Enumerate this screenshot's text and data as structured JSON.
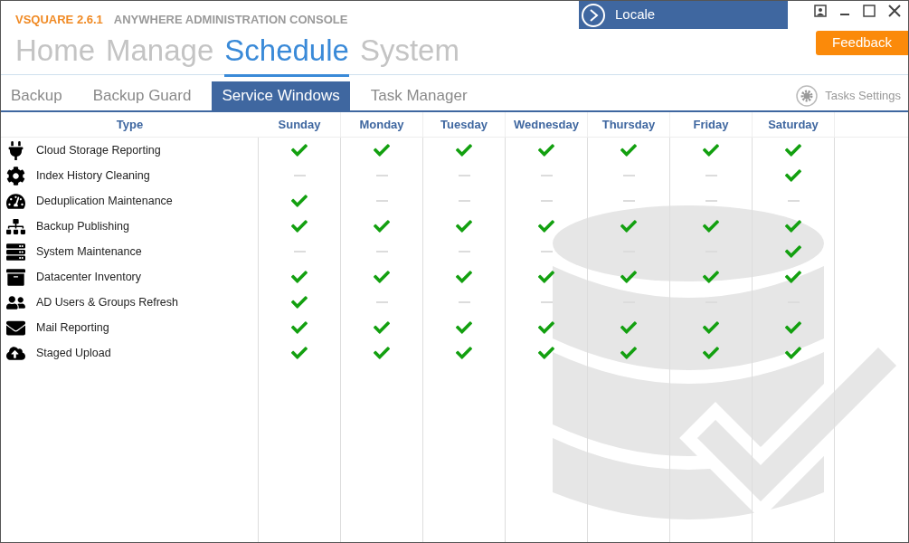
{
  "app": {
    "brand": "VSQUARE 2.6.1",
    "title": "ANYWHERE ADMINISTRATION CONSOLE"
  },
  "locale": {
    "label": "Locale"
  },
  "feedback": "Feedback",
  "nav": [
    {
      "label": "Home",
      "selected": false
    },
    {
      "label": "Manage",
      "selected": false
    },
    {
      "label": "Schedule",
      "selected": true
    },
    {
      "label": "System",
      "selected": false
    }
  ],
  "subtabs": [
    {
      "label": "Backup",
      "selected": false
    },
    {
      "label": "Backup Guard",
      "selected": false
    },
    {
      "label": "Service Windows",
      "selected": true
    },
    {
      "label": "Task Manager",
      "selected": false
    }
  ],
  "tasks_settings": "Tasks Settings",
  "table": {
    "columns": [
      "Type",
      "Sunday",
      "Monday",
      "Tuesday",
      "Wednesday",
      "Thursday",
      "Friday",
      "Saturday"
    ],
    "rows": [
      {
        "name": "Cloud Storage Reporting",
        "kind": "plug",
        "days": [
          true,
          true,
          true,
          true,
          true,
          true,
          true
        ]
      },
      {
        "name": "Index History Cleaning",
        "kind": "gear",
        "days": [
          false,
          false,
          false,
          false,
          false,
          false,
          true
        ]
      },
      {
        "name": "Deduplication Maintenance",
        "kind": "gauge",
        "days": [
          true,
          false,
          false,
          false,
          false,
          false,
          false
        ]
      },
      {
        "name": "Backup Publishing",
        "kind": "sitemap",
        "days": [
          true,
          true,
          true,
          true,
          true,
          true,
          true
        ]
      },
      {
        "name": "System Maintenance",
        "kind": "toggles",
        "days": [
          false,
          false,
          false,
          false,
          false,
          false,
          true
        ]
      },
      {
        "name": "Datacenter Inventory",
        "kind": "bin",
        "days": [
          true,
          true,
          true,
          true,
          true,
          true,
          true
        ]
      },
      {
        "name": "AD Users & Groups Refresh",
        "kind": "users",
        "days": [
          true,
          false,
          false,
          false,
          false,
          false,
          false
        ]
      },
      {
        "name": "Mail Reporting",
        "kind": "mail",
        "days": [
          true,
          true,
          true,
          true,
          true,
          true,
          true
        ]
      },
      {
        "name": "Staged Upload",
        "kind": "cloud",
        "days": [
          true,
          true,
          true,
          true,
          true,
          true,
          true
        ]
      }
    ]
  }
}
